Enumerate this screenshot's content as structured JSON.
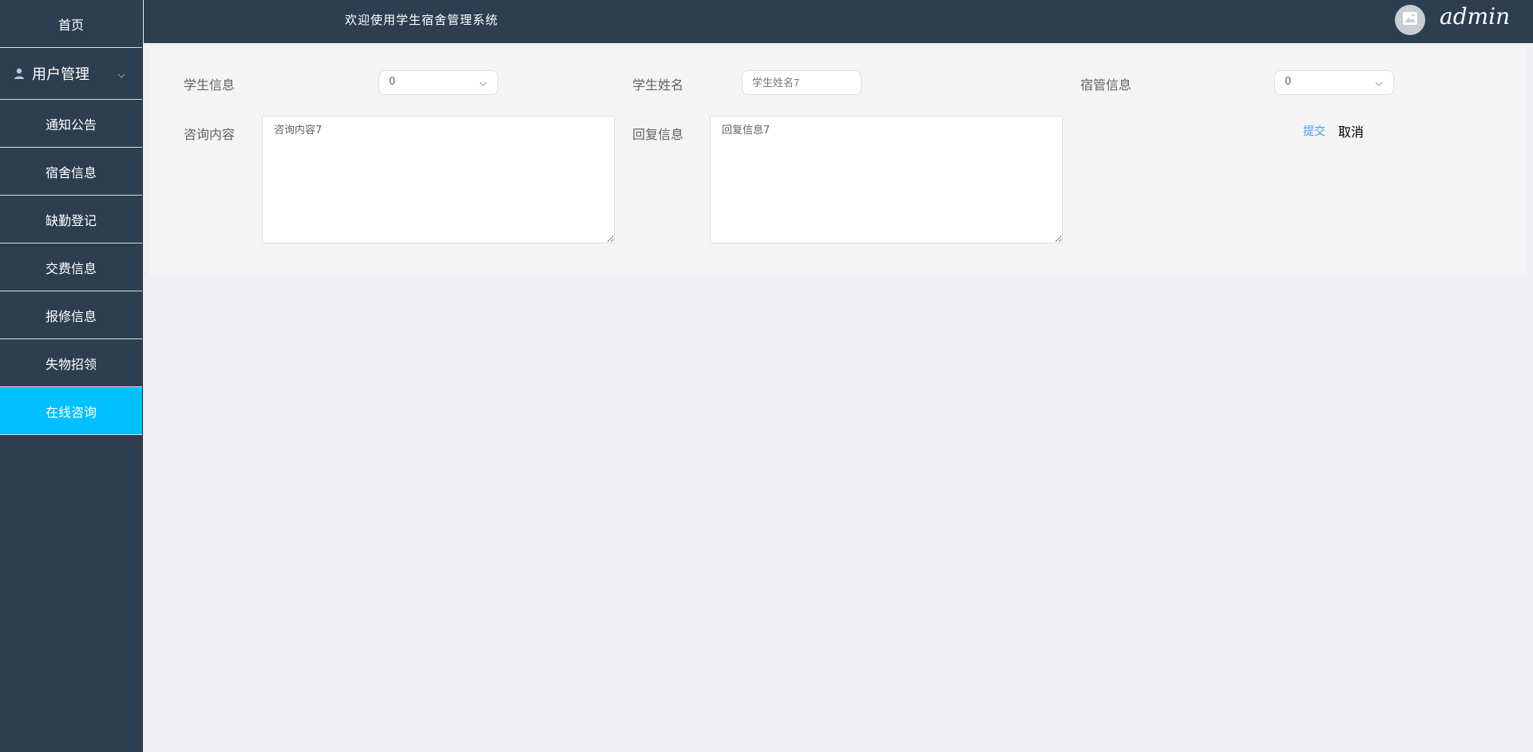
{
  "sidebar": {
    "home": "首页",
    "group": "用户管理",
    "items": [
      "通知公告",
      "宿舍信息",
      "缺勤登记",
      "交费信息",
      "报修信息",
      "失物招领",
      "在线咨询"
    ],
    "active_color": "#00c0ff",
    "bg_color": "#2c3e50"
  },
  "header": {
    "title": "欢迎使用学生宿舍管理系统",
    "username": "admin"
  },
  "form": {
    "student_info_label": "学生信息",
    "student_info_value": "0",
    "student_name_label": "学生姓名",
    "student_name_placeholder": "学生姓名7",
    "dorm_manager_label": "宿管信息",
    "dorm_manager_value": "0",
    "consult_label": "咨询内容",
    "consult_value": "咨询内容7",
    "reply_label": "回复信息",
    "reply_value": "回复信息7",
    "submit_label": "提交",
    "cancel_label": "取消"
  }
}
